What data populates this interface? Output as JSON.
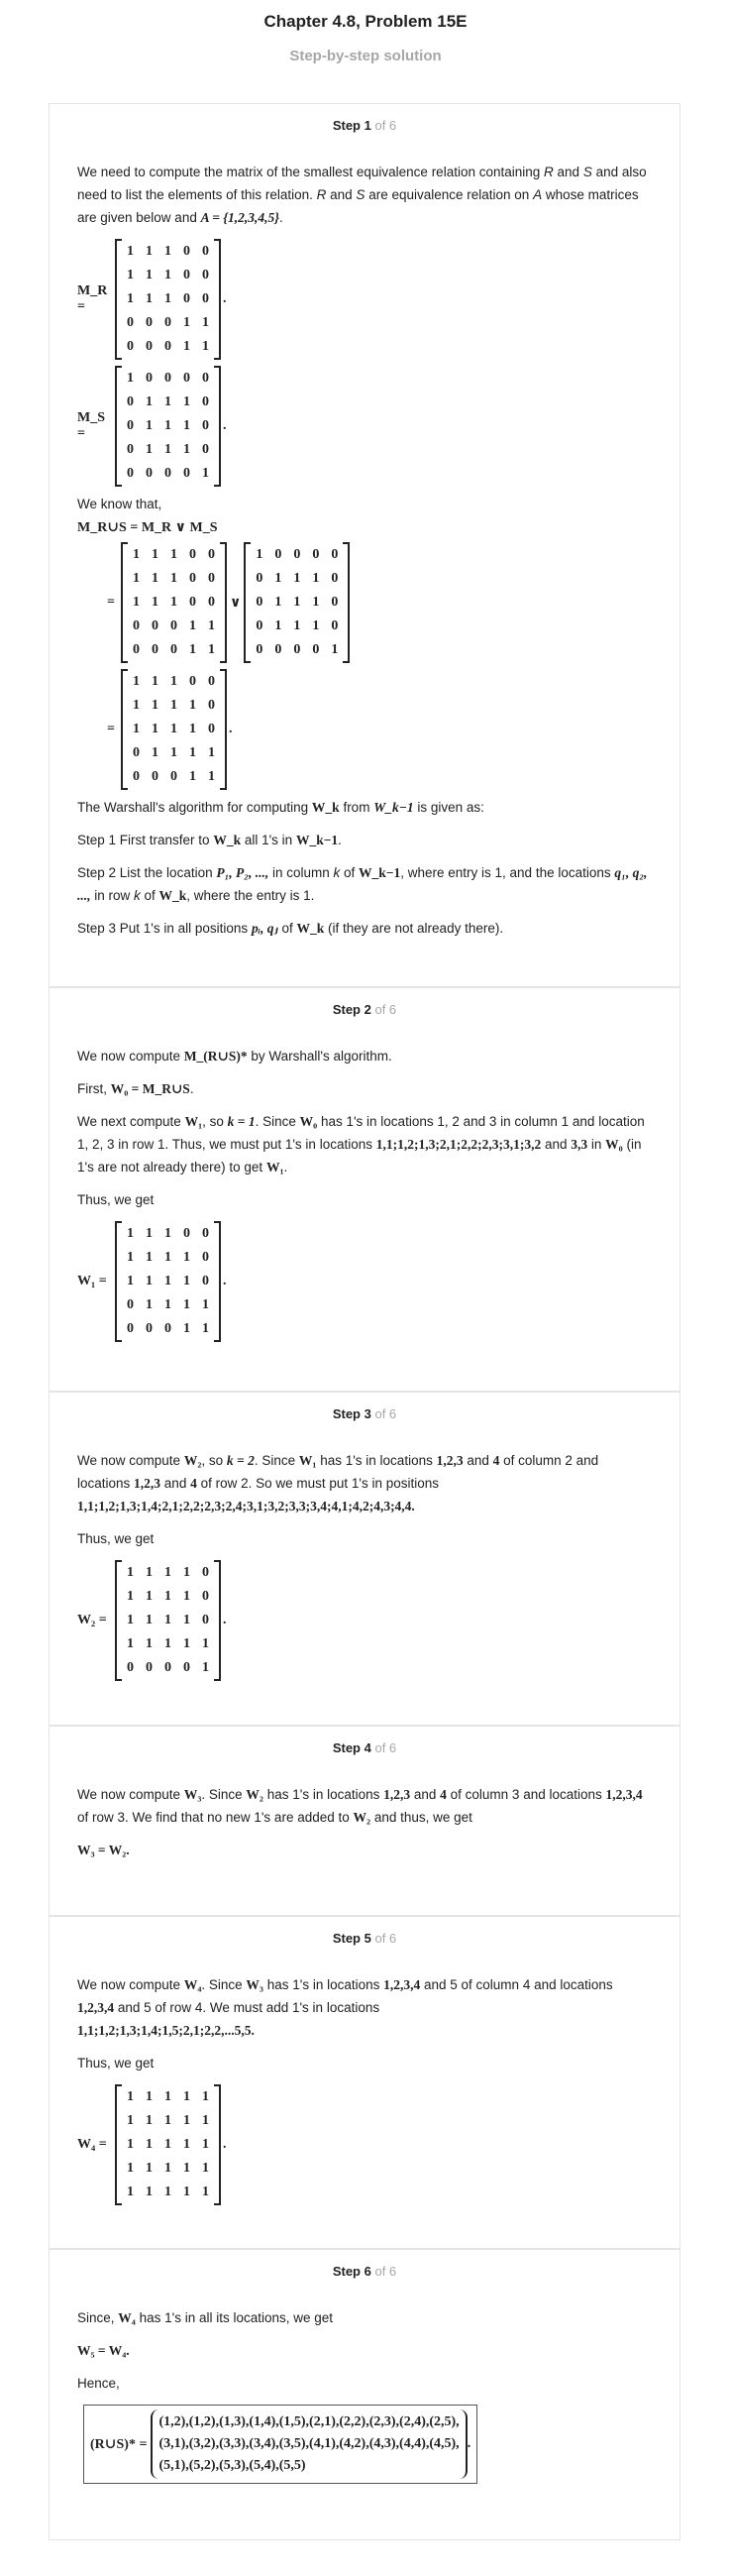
{
  "header": {
    "title": "Chapter 4.8, Problem 15E",
    "subtitle": "Step-by-step solution"
  },
  "step_of": "of 6",
  "steps": [
    {
      "label": "Step 1"
    },
    {
      "label": "Step 2"
    },
    {
      "label": "Step 3"
    },
    {
      "label": "Step 4"
    },
    {
      "label": "Step 5"
    },
    {
      "label": "Step 6"
    }
  ],
  "s1": {
    "intro_a": "We need to compute the matrix of the smallest equivalence relation containing ",
    "R": "R",
    "and": " and ",
    "S": "S",
    "intro_b": " and also need to list the elements of this relation. ",
    "intro_c": " are equivalence relation on ",
    "A": "A",
    "intro_d": " whose matrices are given below and ",
    "Aset": "A = {1,2,3,4,5}",
    "dot": ".",
    "MR": "M_R =",
    "MS": "M_S =",
    "mr": [
      [
        "1",
        "1",
        "1",
        "0",
        "0"
      ],
      [
        "1",
        "1",
        "1",
        "0",
        "0"
      ],
      [
        "1",
        "1",
        "1",
        "0",
        "0"
      ],
      [
        "0",
        "0",
        "0",
        "1",
        "1"
      ],
      [
        "0",
        "0",
        "0",
        "1",
        "1"
      ]
    ],
    "ms": [
      [
        "1",
        "0",
        "0",
        "0",
        "0"
      ],
      [
        "0",
        "1",
        "1",
        "1",
        "0"
      ],
      [
        "0",
        "1",
        "1",
        "1",
        "0"
      ],
      [
        "0",
        "1",
        "1",
        "1",
        "0"
      ],
      [
        "0",
        "0",
        "0",
        "0",
        "1"
      ]
    ],
    "know": "We know that,",
    "MRUS": "M_R∪S = M_R ∨ M_S",
    "eq": "=",
    "or": "∨",
    "mrus": [
      [
        "1",
        "1",
        "1",
        "0",
        "0"
      ],
      [
        "1",
        "1",
        "1",
        "1",
        "0"
      ],
      [
        "1",
        "1",
        "1",
        "1",
        "0"
      ],
      [
        "0",
        "1",
        "1",
        "1",
        "1"
      ],
      [
        "0",
        "0",
        "0",
        "1",
        "1"
      ]
    ],
    "warshall_intro": "The Warshall's algorithm for computing ",
    "wk": "W_k",
    "from": " from ",
    "wk1": "W_k−1",
    "given": " is given as:",
    "st1a": "Step 1 First transfer to ",
    "st1b": " all 1's in ",
    "st2a": "Step 2 List the location ",
    "p": "P₁, P₂, ...,",
    "st2b": " in column ",
    "k": "k",
    "st2c": " of ",
    "st2d": ", where entry is 1, and the locations ",
    "q": "q₁, q₂, ...,",
    "st2e": " in row ",
    "st2f": ", where the entry is 1.",
    "st3a": "Step 3 Put 1's in all positions ",
    "pq": "pᵢ, qⱼ",
    "st3b": " of ",
    "st3c": " (if they are not already there)."
  },
  "s2": {
    "a": "We now compute ",
    "m": "M_(R∪S)*",
    "b": " by Warshall's algorithm.",
    "first": "First, ",
    "w0": "W₀ = M_R∪S",
    "n1": "We next compute ",
    "w1": "W₁",
    "n2": ", so ",
    "k1": "k = 1",
    "n3": ". Since ",
    "w0b": "W₀",
    "n4": " has 1's in locations 1, 2 and 3 in column 1 and location 1, 2, 3 in row 1. Thus, we must put 1's in locations ",
    "locs": "1,1;1,2;1,3;2,1;2,2;2,3;3,1;3,2",
    "n5": " and ",
    "loc33": "3,3",
    "n6": " in ",
    "n7": " (in 1's are not already there) to get ",
    "thus": "Thus, we get",
    "W1": "W₁ =",
    "w1m": [
      [
        "1",
        "1",
        "1",
        "0",
        "0"
      ],
      [
        "1",
        "1",
        "1",
        "1",
        "0"
      ],
      [
        "1",
        "1",
        "1",
        "1",
        "0"
      ],
      [
        "0",
        "1",
        "1",
        "1",
        "1"
      ],
      [
        "0",
        "0",
        "0",
        "1",
        "1"
      ]
    ]
  },
  "s3": {
    "a": "We now compute ",
    "w2": "W₂",
    "b": ", so ",
    "k2": "k = 2",
    "c": ". Since ",
    "w1": "W₁",
    "d": " has 1's in locations ",
    "l1": "1,2,3",
    "e": " and ",
    "l4": "4",
    "f": " of column 2 and locations ",
    "g": " of row 2. So we must put 1's in positions",
    "locs": "1,1;1,2;1,3;1,4;2,1;2,2;2,3;2,4;3,1;3,2;3,3;3,4;4,1;4,2;4,3;4,4.",
    "thus": "Thus, we get",
    "W2": "W₂ =",
    "w2m": [
      [
        "1",
        "1",
        "1",
        "1",
        "0"
      ],
      [
        "1",
        "1",
        "1",
        "1",
        "0"
      ],
      [
        "1",
        "1",
        "1",
        "1",
        "0"
      ],
      [
        "1",
        "1",
        "1",
        "1",
        "1"
      ],
      [
        "0",
        "0",
        "0",
        "0",
        "1"
      ]
    ]
  },
  "s4": {
    "a": "We now compute ",
    "w3": "W₃",
    "b": ". Since ",
    "w2": "W₂",
    "c": " has 1's in locations ",
    "l": "1,2,3",
    "d": " and ",
    "l4": "4",
    "e": " of column 3 and locations ",
    "l2": "1,2,3,4",
    "f": " of row 3. We find that no new 1's are added to ",
    "g": " and thus, we get",
    "res": "W₃ = W₂."
  },
  "s5": {
    "a": "We now compute ",
    "w4": "W₄",
    "b": ". Since ",
    "w3": "W₃",
    "c": " has 1's in locations ",
    "l": "1,2,3,4",
    "d": " and 5 of column 4 and locations ",
    "e": " and 5 of row 4. We must add 1's in locations",
    "locs": "1,1;1,2;1,3;1,4;1,5;2,1;2,2,...5,5.",
    "thus": "Thus, we get",
    "W4": "W₄ =",
    "w4m": [
      [
        "1",
        "1",
        "1",
        "1",
        "1"
      ],
      [
        "1",
        "1",
        "1",
        "1",
        "1"
      ],
      [
        "1",
        "1",
        "1",
        "1",
        "1"
      ],
      [
        "1",
        "1",
        "1",
        "1",
        "1"
      ],
      [
        "1",
        "1",
        "1",
        "1",
        "1"
      ]
    ]
  },
  "s6": {
    "since": "Since, ",
    "w4": "W₄",
    "a": " has 1's in all its locations, we get",
    "res": "W₅ = W₄.",
    "hence": "Hence,",
    "lhs": "(R∪S)* =",
    "line1": "(1,2),(1,2),(1,3),(1,4),(1,5),(2,1),(2,2),(2,3),(2,4),(2,5),",
    "line2": "(3,1),(3,2),(3,3),(3,4),(3,5),(4,1),(4,2),(4,3),(4,4),(4,5),",
    "line3": "(5,1),(5,2),(5,3),(5,4),(5,5)",
    "tail": "."
  }
}
